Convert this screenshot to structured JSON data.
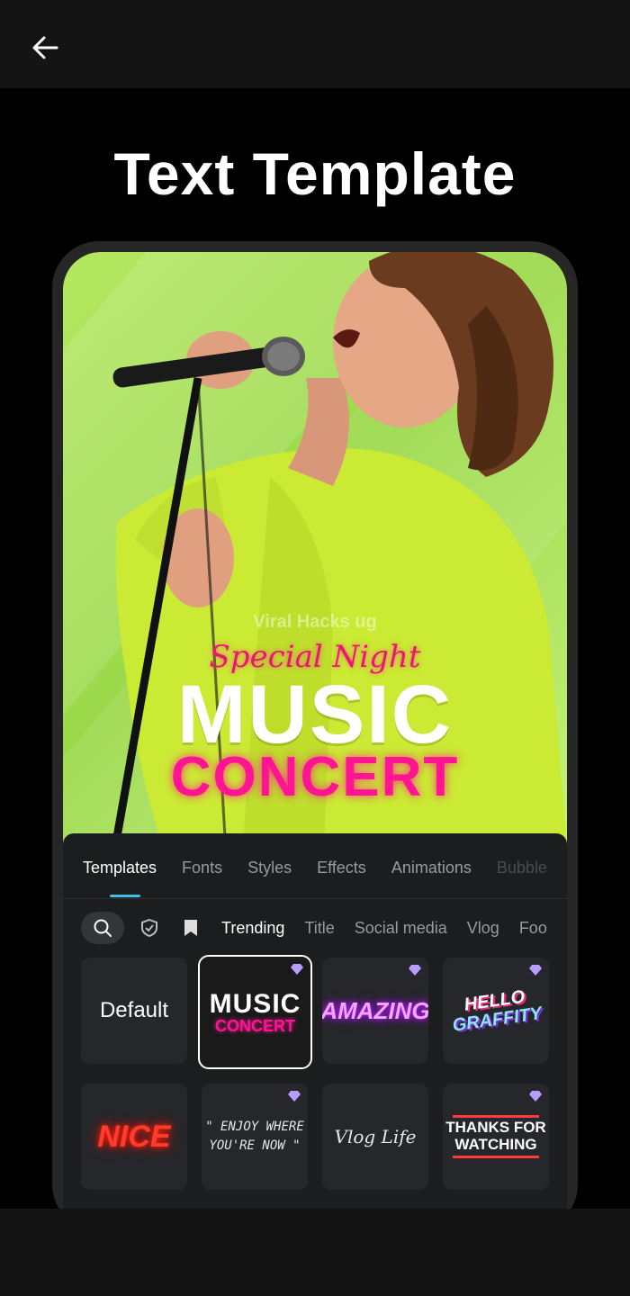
{
  "header": {
    "back_icon": "arrow-left-icon"
  },
  "page_title": "Text Template",
  "preview": {
    "overlay_script": "Special Night",
    "overlay_watermark": "Viral Hacks ug",
    "overlay_title_1": "MUSIC",
    "overlay_title_2": "CONCERT",
    "background_color": "#a8e256"
  },
  "panel": {
    "tabs": [
      {
        "label": "Templates",
        "active": true
      },
      {
        "label": "Fonts"
      },
      {
        "label": "Styles"
      },
      {
        "label": "Effects"
      },
      {
        "label": "Animations"
      },
      {
        "label": "Bubble"
      }
    ],
    "filters": {
      "icons": [
        "search-icon",
        "shield-check-icon",
        "bookmark-icon"
      ],
      "chips": [
        {
          "label": "Trending",
          "active": true
        },
        {
          "label": "Title"
        },
        {
          "label": "Social media"
        },
        {
          "label": "Vlog"
        },
        {
          "label": "Foo"
        }
      ]
    },
    "templates": [
      {
        "label": "Default"
      },
      {
        "line1": "MUSIC",
        "line2": "CONCERT",
        "premium": true,
        "selected": true
      },
      {
        "label": "AMAZING",
        "premium": true
      },
      {
        "line1": "HELLO",
        "line2": "GRAFFITY",
        "premium": true
      },
      {
        "label": "NICE"
      },
      {
        "line1": "\" ENJOY WHERE",
        "line2": "YOU'RE NOW \"",
        "premium": true
      },
      {
        "label": "Vlog Life"
      },
      {
        "line1": "THANKS FOR",
        "line2": "WATCHING",
        "premium": true
      }
    ]
  },
  "colors": {
    "accent": "#3cc1e6",
    "pink": "#ff1493",
    "panel_bg": "#1c1d1f"
  }
}
